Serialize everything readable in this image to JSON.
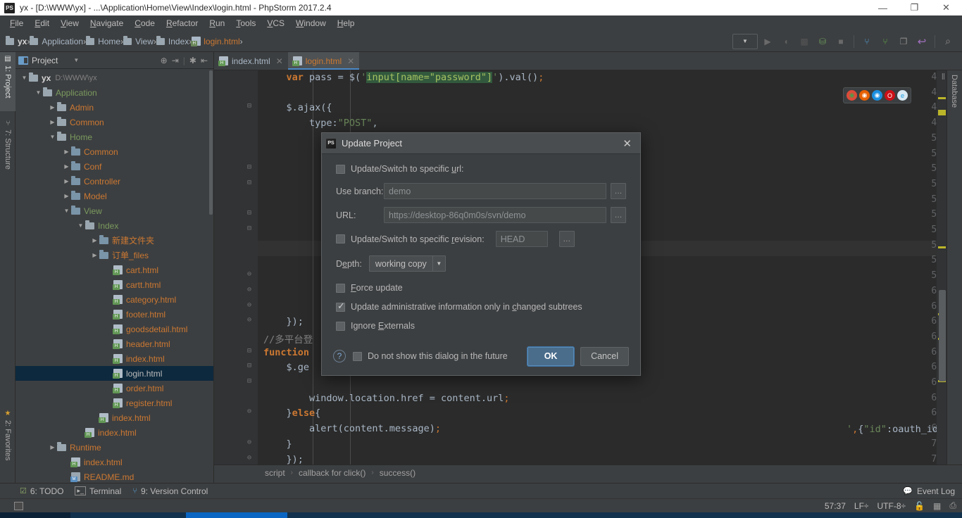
{
  "window": {
    "title": "yx - [D:\\WWW\\yx] - ...\\Application\\Home\\View\\Index\\login.html - PhpStorm 2017.2.4",
    "minimize": "—",
    "maximize": "❐",
    "close": "✕"
  },
  "menubar": {
    "items": [
      "File",
      "Edit",
      "View",
      "Navigate",
      "Code",
      "Refactor",
      "Run",
      "Tools",
      "VCS",
      "Window",
      "Help"
    ]
  },
  "breadcrumbs": {
    "items": [
      {
        "label": "yx",
        "type": "folder-bold"
      },
      {
        "label": "Application",
        "type": "folder"
      },
      {
        "label": "Home",
        "type": "folder"
      },
      {
        "label": "View",
        "type": "folder"
      },
      {
        "label": "Index",
        "type": "folder"
      },
      {
        "label": "login.html",
        "type": "file"
      }
    ],
    "separator": "›"
  },
  "toolbar": {
    "run_config_label": "▼",
    "buttons": [
      "run",
      "debug",
      "coverage",
      "profile",
      "stop",
      "vcs-update",
      "vcs-commit",
      "screen",
      "revert",
      "search"
    ]
  },
  "left_strip": {
    "tabs": [
      {
        "label": "1: Project",
        "active": true
      },
      {
        "label": "7: Structure",
        "active": false
      },
      {
        "label": "2: Favorites",
        "active": false
      }
    ]
  },
  "project_panel": {
    "title": "Project",
    "caret": "▼",
    "actions": [
      "target-icon",
      "collapse-icon",
      "settings-icon",
      "hide-icon"
    ],
    "tree": [
      {
        "depth": 0,
        "twisty": "▼",
        "icon": "folder",
        "label": "yx",
        "style": "white",
        "path": "D:\\WWW\\yx"
      },
      {
        "depth": 1,
        "twisty": "▼",
        "icon": "folder",
        "label": "Application",
        "style": "green"
      },
      {
        "depth": 2,
        "twisty": "▶",
        "icon": "folder",
        "label": "Admin",
        "style": "orange"
      },
      {
        "depth": 2,
        "twisty": "▶",
        "icon": "folder",
        "label": "Common",
        "style": "orange"
      },
      {
        "depth": 2,
        "twisty": "▼",
        "icon": "folder",
        "label": "Home",
        "style": "green"
      },
      {
        "depth": 3,
        "twisty": "▶",
        "icon": "folder-blue",
        "label": "Common",
        "style": "orange"
      },
      {
        "depth": 3,
        "twisty": "▶",
        "icon": "folder-blue",
        "label": "Conf",
        "style": "orange"
      },
      {
        "depth": 3,
        "twisty": "▶",
        "icon": "folder-blue",
        "label": "Controller",
        "style": "orange"
      },
      {
        "depth": 3,
        "twisty": "▶",
        "icon": "folder-blue",
        "label": "Model",
        "style": "orange"
      },
      {
        "depth": 3,
        "twisty": "▼",
        "icon": "folder-blue",
        "label": "View",
        "style": "green"
      },
      {
        "depth": 4,
        "twisty": "▼",
        "icon": "folder",
        "label": "Index",
        "style": "green"
      },
      {
        "depth": 5,
        "twisty": "▶",
        "icon": "folder-blue",
        "label": "新建文件夹",
        "style": "orange"
      },
      {
        "depth": 5,
        "twisty": "▶",
        "icon": "folder-blue",
        "label": "订单_files",
        "style": "orange"
      },
      {
        "depth": 6,
        "twisty": "",
        "icon": "html",
        "label": "cart.html",
        "style": "orange"
      },
      {
        "depth": 6,
        "twisty": "",
        "icon": "html",
        "label": "cartt.html",
        "style": "orange"
      },
      {
        "depth": 6,
        "twisty": "",
        "icon": "html",
        "label": "category.html",
        "style": "orange"
      },
      {
        "depth": 6,
        "twisty": "",
        "icon": "html",
        "label": "footer.html",
        "style": "orange"
      },
      {
        "depth": 6,
        "twisty": "",
        "icon": "html",
        "label": "goodsdetail.html",
        "style": "orange"
      },
      {
        "depth": 6,
        "twisty": "",
        "icon": "html",
        "label": "header.html",
        "style": "orange"
      },
      {
        "depth": 6,
        "twisty": "",
        "icon": "html",
        "label": "index.html",
        "style": "orange"
      },
      {
        "depth": 6,
        "twisty": "",
        "icon": "html",
        "label": "login.html",
        "style": "gray",
        "selected": true
      },
      {
        "depth": 6,
        "twisty": "",
        "icon": "html",
        "label": "order.html",
        "style": "orange"
      },
      {
        "depth": 6,
        "twisty": "",
        "icon": "html",
        "label": "register.html",
        "style": "orange"
      },
      {
        "depth": 5,
        "twisty": "",
        "icon": "html",
        "label": "index.html",
        "style": "orange"
      },
      {
        "depth": 4,
        "twisty": "",
        "icon": "html",
        "label": "index.html",
        "style": "orange"
      },
      {
        "depth": 2,
        "twisty": "▶",
        "icon": "folder",
        "label": "Runtime",
        "style": "orange"
      },
      {
        "depth": 3,
        "twisty": "",
        "icon": "html",
        "label": "index.html",
        "style": "orange"
      },
      {
        "depth": 3,
        "twisty": "",
        "icon": "md",
        "label": "README.md",
        "style": "orange"
      }
    ]
  },
  "editor_tabs": [
    {
      "label": "index.html",
      "active": false,
      "close": "✕"
    },
    {
      "label": "login.html",
      "active": true,
      "close": "✕"
    }
  ],
  "editor": {
    "first_line": 46,
    "lines": [
      {
        "n": 46,
        "fold": "",
        "html": "    <span class=\"kw\">var</span> pass = $(<span class=\"str\">'</span><span class=\"hl-str\">input[name=\"password\"]</span><span class=\"str\">'</span>).val()<span class=\"sem\">;</span>"
      },
      {
        "n": 47,
        "fold": "",
        "html": ""
      },
      {
        "n": 48,
        "fold": "⊟",
        "html": "    $.ajax({"
      },
      {
        "n": 49,
        "fold": "",
        "html": "        type:<span class=\"str\">\"POST\"</span>,"
      },
      {
        "n": 50,
        "fold": "",
        "html": ""
      },
      {
        "n": 51,
        "fold": "",
        "html": ""
      },
      {
        "n": 52,
        "fold": "⊟",
        "html": ""
      },
      {
        "n": 53,
        "fold": "⊟",
        "html": ""
      },
      {
        "n": 54,
        "fold": "",
        "html": ""
      },
      {
        "n": 55,
        "fold": "⊟",
        "html": ""
      },
      {
        "n": 56,
        "fold": "⊟",
        "html": ""
      },
      {
        "n": 57,
        "fold": "",
        "html": ""
      },
      {
        "n": 58,
        "fold": "",
        "html": ""
      },
      {
        "n": 59,
        "fold": "⊖",
        "html": ""
      },
      {
        "n": 60,
        "fold": "⊖",
        "html": ""
      },
      {
        "n": 61,
        "fold": "⊖",
        "html": ""
      },
      {
        "n": 62,
        "fold": "⊖",
        "html": "    });"
      },
      {
        "n": 63,
        "fold": "",
        "html": "<span class=\"cmt\">//多平台登</span>"
      },
      {
        "n": 64,
        "fold": "⊟",
        "html": "<span class=\"kw\">function</span>"
      },
      {
        "n": 65,
        "fold": "⊟",
        "html": "    $.ge"
      },
      {
        "n": 66,
        "fold": "⊟",
        "html": ""
      },
      {
        "n": 67,
        "fold": "",
        "html": "        window.location.href = content.url<span class=\"sem\">;</span>"
      },
      {
        "n": 68,
        "fold": "⊖",
        "html": "    }<span class=\"kw\">else</span>{"
      },
      {
        "n": 69,
        "fold": "",
        "html": "        alert(content.message)<span class=\"sem\">;</span>"
      },
      {
        "n": 70,
        "fold": "⊖",
        "html": "    }"
      },
      {
        "n": 71,
        "fold": "⊖",
        "html": "    });"
      },
      {
        "n": 72,
        "fold": "⊖",
        "html": "}"
      }
    ],
    "overlay_right_65": "<span class=\"str\">'</span><span class=\"sem\">,</span>{<span class=\"str\">\"id\"</span>:oauth_id}<span class=\"sem\">,</span><span class=\"kw\">function</span>(content){",
    "browsers": [
      {
        "name": "chrome-icon",
        "glyph": "◉",
        "color": "#4a9e4a",
        "bg": "#dd4b39"
      },
      {
        "name": "firefox-icon",
        "glyph": "◉",
        "color": "#fff",
        "bg": "#e66000"
      },
      {
        "name": "safari-icon",
        "glyph": "◉",
        "color": "#fff",
        "bg": "#1b8fe0"
      },
      {
        "name": "opera-icon",
        "glyph": "O",
        "color": "#fff",
        "bg": "#cc0f16"
      },
      {
        "name": "ie-icon",
        "glyph": "e",
        "color": "#1ba1e2",
        "bg": "#d8e8f2"
      }
    ],
    "database_tab": "Database"
  },
  "editor_breadcrumbs": {
    "items": [
      "script",
      "callback for click()",
      "success()"
    ],
    "separator": "›"
  },
  "bottom_bar": {
    "items": [
      {
        "label": "6: TODO",
        "icon": "todo-icon"
      },
      {
        "label": "Terminal",
        "icon": "terminal-icon"
      },
      {
        "label": "9: Version Control",
        "icon": "vcs-icon"
      }
    ],
    "event_log": "Event Log",
    "event_log_icon": "balloon-icon"
  },
  "statusbar": {
    "caret_position": "57:37",
    "line_separator": "LF÷",
    "encoding": "UTF-8÷",
    "lock_icon": "lock-icon",
    "grid_icon": "grid-icon",
    "inspection_icon": "inspection-icon"
  },
  "dialog": {
    "title": "Update Project",
    "close": "✕",
    "checkbox_url": {
      "label_pre": "Update/Switch to specific ",
      "label_key": "u",
      "label_post": "rl:",
      "checked": false
    },
    "branch": {
      "label_pre": "Use branch:",
      "label_key": "",
      "value": "demo",
      "browse": "…"
    },
    "url": {
      "label": "URL:",
      "value": "https://desktop-86q0m0s/svn/demo",
      "browse": "…"
    },
    "checkbox_revision": {
      "label_pre": "Update/Switch to specific ",
      "label_key": "r",
      "label_post": "evision:",
      "checked": false,
      "value": "HEAD",
      "browse": "…"
    },
    "depth": {
      "label_pre": "D",
      "label_key": "e",
      "label_post": "pth:",
      "value": "working copy",
      "arrow": "▼"
    },
    "checkbox_force": {
      "label_pre": "",
      "label_key": "F",
      "label_post": "orce update",
      "checked": false
    },
    "checkbox_admin": {
      "label_pre": "Update administrative information only in ",
      "label_key": "c",
      "label_post": "hanged subtrees",
      "checked": true
    },
    "checkbox_externals": {
      "label_pre": "Ignore ",
      "label_key": "E",
      "label_post": "xternals",
      "checked": false
    },
    "help": "?",
    "checkbox_dontshow": {
      "label": "Do not show this dialog in the future",
      "checked": false
    },
    "ok": "OK",
    "cancel": "Cancel"
  },
  "colors": {
    "accent_blue": "#4a88c7",
    "ide_bg": "#3c3f41",
    "editor_bg": "#2b2b2b",
    "keyword_orange": "#cc7832",
    "string_green": "#6a8759",
    "selected_row": "#0d293e"
  }
}
